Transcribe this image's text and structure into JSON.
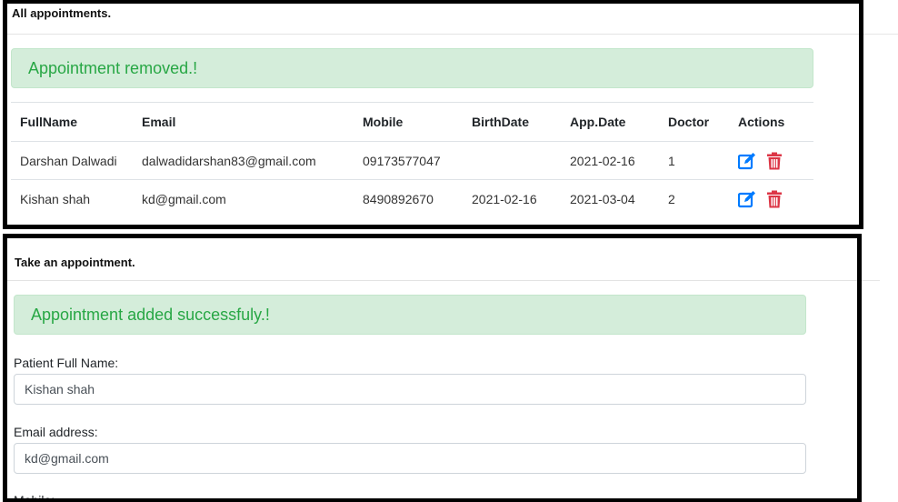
{
  "appointments_panel": {
    "title": "All appointments.",
    "alert": "Appointment removed.!",
    "columns": [
      "FullName",
      "Email",
      "Mobile",
      "BirthDate",
      "App.Date",
      "Doctor",
      "Actions"
    ],
    "rows": [
      {
        "fullname": "Darshan Dalwadi",
        "email": "dalwadidarshan83@gmail.com",
        "mobile": "09173577047",
        "birthdate": "",
        "app_date": "2021-02-16",
        "doctor": "1"
      },
      {
        "fullname": "Kishan shah",
        "email": "kd@gmail.com",
        "mobile": "8490892670",
        "birthdate": "2021-02-16",
        "app_date": "2021-03-04",
        "doctor": "2"
      }
    ]
  },
  "take_panel": {
    "title": "Take an appointment.",
    "alert": "Appointment added successfuly.!",
    "fullname_label": "Patient Full Name:",
    "fullname_value": "Kishan shah",
    "email_label": "Email address:",
    "email_value": "kd@gmail.com",
    "mobile_label": "Mobile:"
  },
  "colors": {
    "edit_icon": "#007bff",
    "delete_icon": "#dc3545",
    "alert_text": "#28a745",
    "alert_bg": "#d4edda"
  },
  "icons": {
    "edit": "edit-icon",
    "delete": "trash-icon"
  }
}
